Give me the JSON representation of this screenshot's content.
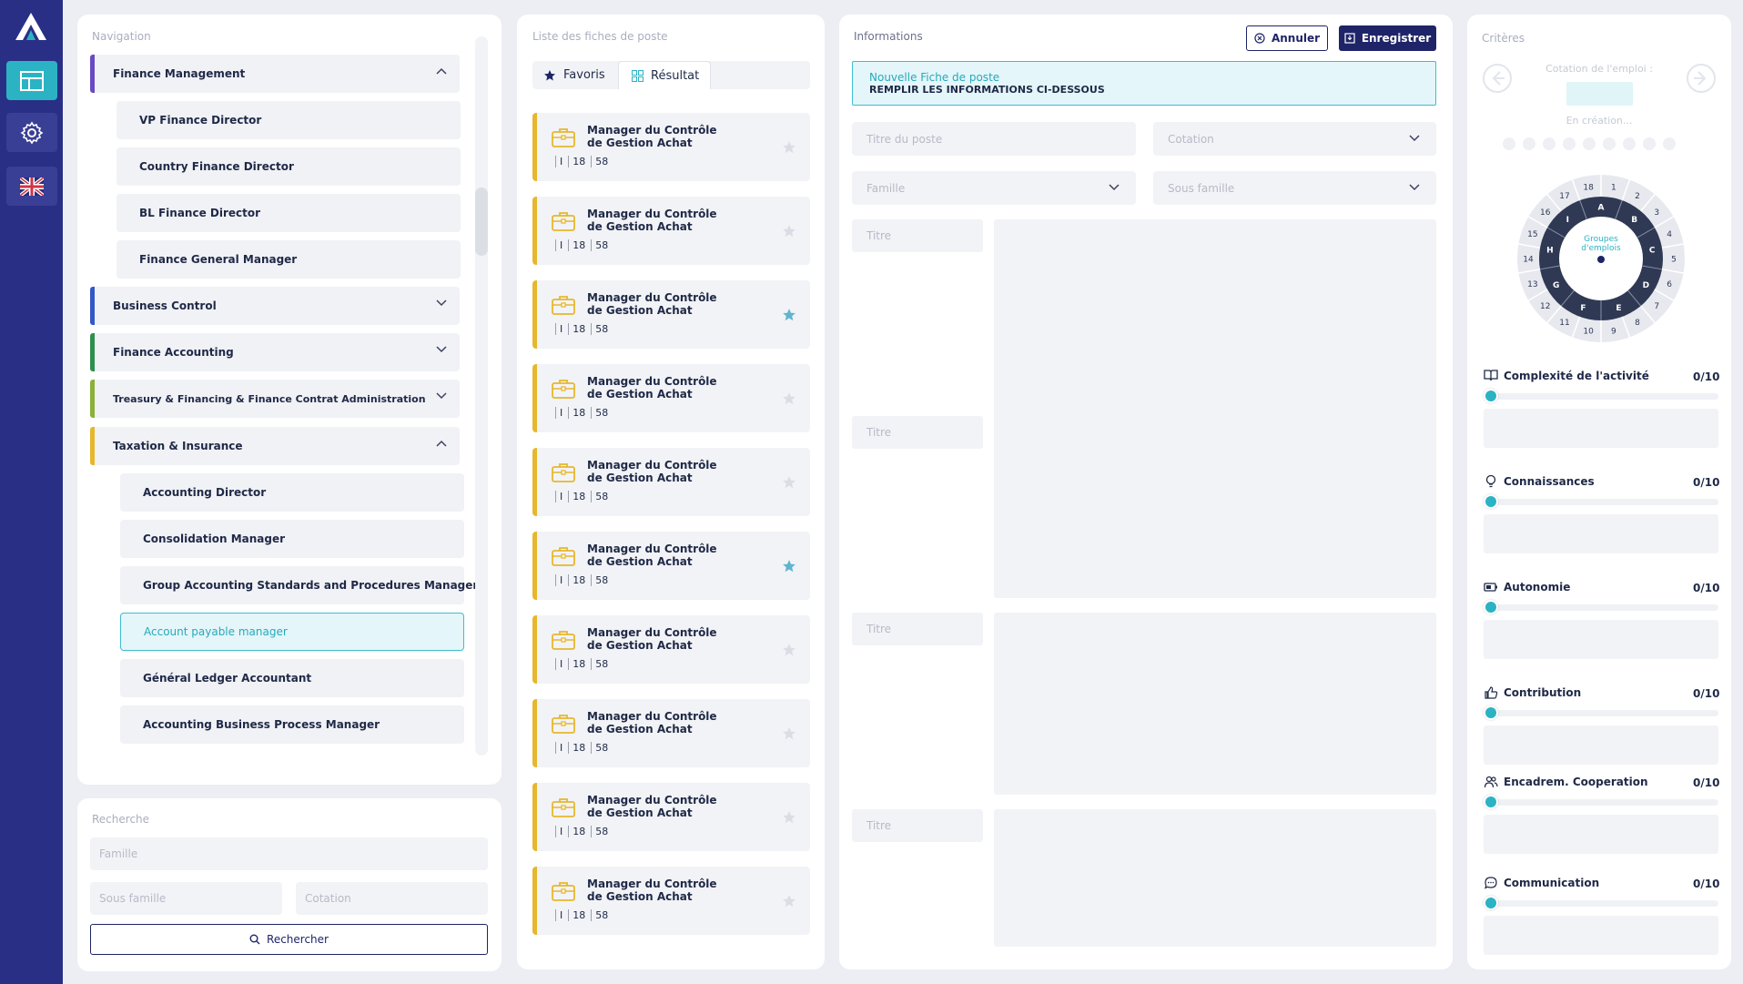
{
  "nav": {
    "title": "Navigation",
    "items": [
      {
        "label": "Finance Management",
        "kind": "category",
        "color": "#6a4ac2",
        "expanded": true
      },
      {
        "label": "VP Finance Director",
        "kind": "sub"
      },
      {
        "label": "Country Finance Director",
        "kind": "sub"
      },
      {
        "label": "BL Finance Director",
        "kind": "sub"
      },
      {
        "label": "Finance General Manager",
        "kind": "sub"
      },
      {
        "label": "Business Control",
        "kind": "category",
        "color": "#3358c7",
        "expanded": false
      },
      {
        "label": "Finance Accounting",
        "kind": "category",
        "color": "#2f8f4e",
        "expanded": false
      },
      {
        "label": "Treasury & Financing & Finance Contrat Administration",
        "kind": "category",
        "color": "#8ab23a",
        "expanded": false
      },
      {
        "label": "Taxation & Insurance",
        "kind": "category",
        "color": "#e6b72d",
        "expanded": true
      },
      {
        "label": "Accounting Director",
        "kind": "sub"
      },
      {
        "label": "Consolidation Manager",
        "kind": "sub"
      },
      {
        "label": "Group Accounting Standards and Procedures Manager",
        "kind": "sub"
      },
      {
        "label": "Account payable manager",
        "kind": "sub",
        "selected": true
      },
      {
        "label": "Général Ledger Accountant",
        "kind": "sub"
      },
      {
        "label": "Accounting Business Process Manager",
        "kind": "sub"
      }
    ]
  },
  "search": {
    "title": "Recherche",
    "famille_placeholder": "Famille",
    "sous_famille_placeholder": "Sous famille",
    "cotation_placeholder": "Cotation",
    "button_label": "Rechercher"
  },
  "list": {
    "title": "Liste des fiches de poste",
    "tabs": [
      {
        "label": "Favoris"
      },
      {
        "label": "Résultat",
        "active": true
      }
    ],
    "cards": [
      {
        "line1": "Manager du Contrôle",
        "line2": "de Gestion Achat",
        "n1": "I",
        "n2": "18",
        "n3": "58",
        "starred": false
      },
      {
        "line1": "Manager du Contrôle",
        "line2": "de Gestion Achat",
        "n1": "I",
        "n2": "18",
        "n3": "58",
        "starred": false
      },
      {
        "line1": "Manager du Contrôle",
        "line2": "de Gestion Achat",
        "n1": "I",
        "n2": "18",
        "n3": "58",
        "starred": true
      },
      {
        "line1": "Manager du Contrôle",
        "line2": "de Gestion Achat",
        "n1": "I",
        "n2": "18",
        "n3": "58",
        "starred": false
      },
      {
        "line1": "Manager du Contrôle",
        "line2": "de Gestion Achat",
        "n1": "I",
        "n2": "18",
        "n3": "58",
        "starred": false
      },
      {
        "line1": "Manager du Contrôle",
        "line2": "de Gestion Achat",
        "n1": "I",
        "n2": "18",
        "n3": "58",
        "starred": true
      },
      {
        "line1": "Manager du Contrôle",
        "line2": "de Gestion Achat",
        "n1": "I",
        "n2": "18",
        "n3": "58",
        "starred": false
      },
      {
        "line1": "Manager du Contrôle",
        "line2": "de Gestion Achat",
        "n1": "I",
        "n2": "18",
        "n3": "58",
        "starred": false
      },
      {
        "line1": "Manager du Contrôle",
        "line2": "de Gestion Achat",
        "n1": "I",
        "n2": "18",
        "n3": "58",
        "starred": false
      },
      {
        "line1": "Manager du Contrôle",
        "line2": "de Gestion Achat",
        "n1": "I",
        "n2": "18",
        "n3": "58",
        "starred": false
      }
    ]
  },
  "info": {
    "title": "Informations",
    "cancel_label": "Annuler",
    "save_label": "Enregistrer",
    "notice_line1": "Nouvelle Fiche de poste",
    "notice_line2": "REMPLIR LES INFORMATIONS CI-DESSOUS",
    "titre_poste_placeholder": "Titre du poste",
    "cotation_placeholder": "Cotation",
    "famille_placeholder": "Famille",
    "sous_famille_placeholder": "Sous famille",
    "section_labels": [
      "Titre",
      "Titre",
      "Titre",
      "Titre"
    ]
  },
  "criteria": {
    "title": "Critères",
    "cotation_label": "Cotation de l'emploi :",
    "status": "En création...",
    "wheel_center": [
      "Groupes",
      "d'emplois"
    ],
    "wheel_numbers": [
      "1",
      "2",
      "3",
      "4",
      "5",
      "6",
      "7",
      "8",
      "9",
      "10",
      "11",
      "12",
      "13",
      "14",
      "15",
      "16",
      "17",
      "18"
    ],
    "wheel_letters": [
      "A",
      "B",
      "C",
      "D",
      "E",
      "F",
      "G",
      "H",
      "I"
    ],
    "items": [
      {
        "label": "Complexité de l'activité",
        "score": "0/10",
        "icon": "book-icon",
        "value": 0
      },
      {
        "label": "Connaissances",
        "score": "0/10",
        "icon": "lightbulb-icon",
        "value": 0
      },
      {
        "label": "Autonomie",
        "score": "0/10",
        "icon": "battery-icon",
        "value": 0
      },
      {
        "label": "Contribution",
        "score": "0/10",
        "icon": "thumbs-up-icon",
        "value": 0
      },
      {
        "label": "Encadrem. Cooperation",
        "score": "0/10",
        "icon": "users-icon",
        "value": 0
      },
      {
        "label": "Communication",
        "score": "0/10",
        "icon": "chat-icon",
        "value": 0
      }
    ]
  },
  "colors": {
    "sidebar": "#2a2f86",
    "accent": "#2bb3c4",
    "navy": "#1e2467",
    "gold": "#e6b72d"
  }
}
